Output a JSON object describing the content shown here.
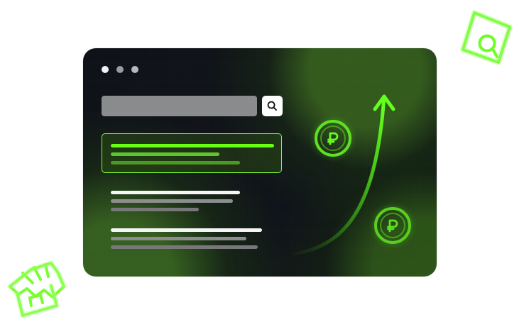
{
  "colors": {
    "accent": "#67ff11",
    "accent_secondary": "#5ec52c",
    "panel": "#0f1319",
    "white": "#ffffff",
    "gray": "#8a8b8d"
  },
  "icons": {
    "top_right": "search-document-icon",
    "bottom_left": "store-icon",
    "search_button": "search-icon",
    "coins": "ruble-coin-icon",
    "arrow": "growth-arrow-icon"
  }
}
